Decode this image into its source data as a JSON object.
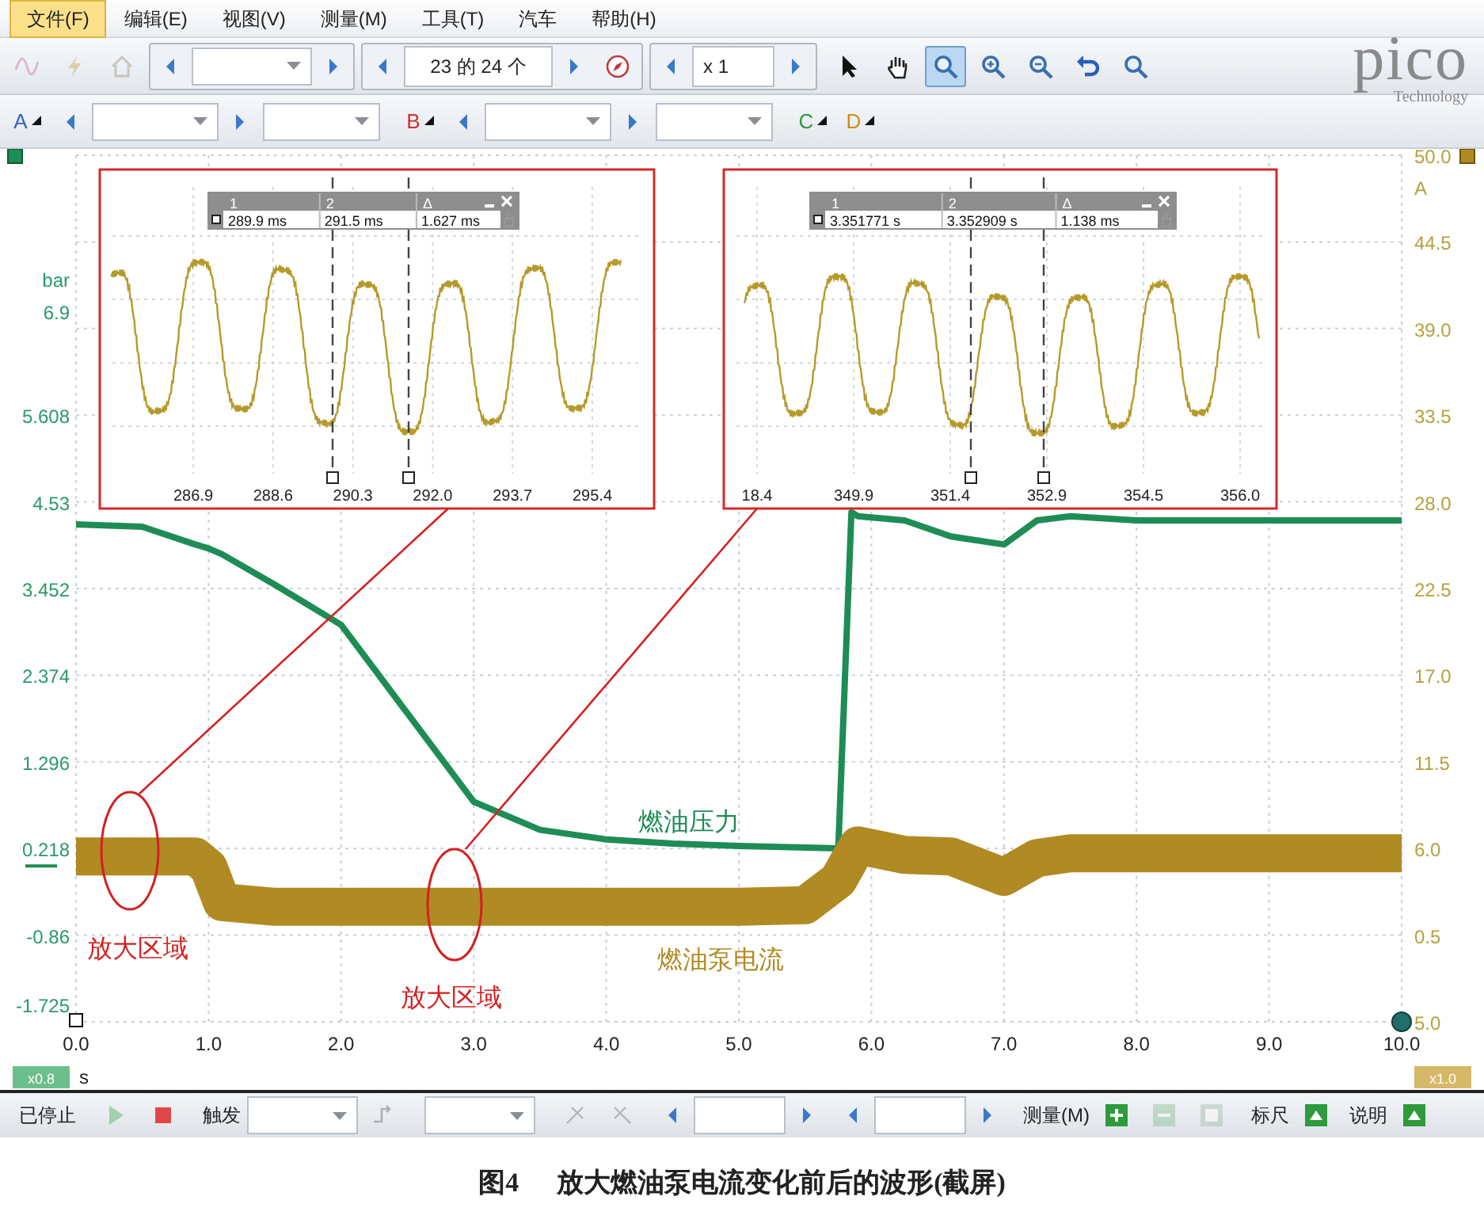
{
  "menu": {
    "items": [
      {
        "label": "文件(F)",
        "selected": true
      },
      {
        "label": "编辑(E)",
        "selected": false
      },
      {
        "label": "视图(V)",
        "selected": false
      },
      {
        "label": "测量(M)",
        "selected": false
      },
      {
        "label": "工具(T)",
        "selected": false
      },
      {
        "label": "汽车",
        "selected": false
      },
      {
        "label": "帮助(H)",
        "selected": false
      }
    ]
  },
  "toolbar_1": {
    "left_tools": [
      {
        "disabled": true
      },
      {
        "disabled": true
      },
      {
        "disabled": true
      }
    ],
    "buffer_counter": "23 的 24 个",
    "zoom_factor": "x 1",
    "view_tools": [
      {
        "selected": false
      },
      {
        "selected": false
      },
      {
        "selected": true
      },
      {
        "selected": false
      },
      {
        "selected": false
      },
      {
        "selected": false
      },
      {
        "selected": false
      }
    ],
    "logo": {
      "name": "pico",
      "tagline": "Technology"
    }
  },
  "toolbar_2": {
    "channels": [
      {
        "label": "A",
        "color": "#2f5fc4"
      },
      {
        "label": "B",
        "color": "#d03030"
      },
      {
        "label": "C",
        "color": "#2e9a3c"
      },
      {
        "label": "D",
        "color": "#d08a10"
      }
    ]
  },
  "scope": {
    "chart_data": {
      "type": "line",
      "xlabel": "s",
      "ylabel": "bar",
      "y2label": "A",
      "x": [
        0,
        0.5,
        0.9,
        1.0,
        1.1,
        1.5,
        2.0,
        2.5,
        3.0,
        3.5,
        4.0,
        4.5,
        5.0,
        5.5,
        5.75,
        5.85,
        5.9,
        6.25,
        6.6,
        7.0,
        7.25,
        7.5,
        8.0,
        9.0,
        10.0
      ],
      "series": [
        {
          "name": "燃油压力",
          "color": "#1e8c55",
          "values": [
            4.25,
            4.22,
            4.0,
            3.95,
            3.88,
            3.5,
            3.0,
            1.9,
            0.8,
            0.45,
            0.33,
            0.28,
            0.25,
            0.23,
            0.22,
            4.4,
            4.35,
            4.3,
            4.1,
            4.0,
            4.3,
            4.35,
            4.3,
            4.3,
            4.3
          ]
        },
        {
          "name": "燃油泵电流",
          "color": "#b08a22",
          "axis": "y2",
          "values": [
            5.5,
            5.5,
            5.5,
            4.8,
            2.6,
            2.3,
            2.3,
            2.3,
            2.3,
            2.3,
            2.3,
            2.3,
            2.3,
            2.4,
            4.0,
            5.5,
            6.2,
            5.6,
            5.5,
            4.2,
            5.4,
            5.7,
            5.7,
            5.7,
            5.7
          ]
        }
      ],
      "grid": true,
      "xlim": [
        0,
        10
      ],
      "ylim": [
        -1.938,
        8.842
      ],
      "y2lim": [
        -5,
        50
      ],
      "xticks": [
        {
          "value": 0,
          "label": "0.0"
        },
        {
          "value": 1,
          "label": "1.0"
        },
        {
          "value": 2,
          "label": "2.0"
        },
        {
          "value": 3,
          "label": "3.0"
        },
        {
          "value": 4,
          "label": "4.0"
        },
        {
          "value": 5,
          "label": "5.0"
        },
        {
          "value": 6,
          "label": "6.0"
        },
        {
          "value": 7,
          "label": "7.0"
        },
        {
          "value": 8,
          "label": "8.0"
        },
        {
          "value": 9,
          "label": "9.0"
        },
        {
          "value": 10,
          "label": "10.0"
        }
      ],
      "yticks": [
        {
          "value": 6.9,
          "label": "6.9"
        },
        {
          "value": 5.608,
          "label": "5.608"
        },
        {
          "value": 4.53,
          "label": "4.53"
        },
        {
          "value": 3.452,
          "label": "3.452"
        },
        {
          "value": 2.374,
          "label": "2.374"
        },
        {
          "value": 1.296,
          "label": "1.296"
        },
        {
          "value": 0.218,
          "label": "0.218"
        },
        {
          "value": -0.86,
          "label": "-0.86"
        },
        {
          "value": -1.725,
          "label": "-1.725"
        }
      ],
      "y2ticks": [
        {
          "value": 50,
          "label": "50.0"
        },
        {
          "value": 44.5,
          "label": "44.5"
        },
        {
          "value": 39,
          "label": "39.0"
        },
        {
          "value": 33.5,
          "label": "33.5"
        },
        {
          "value": 28,
          "label": "28.0"
        },
        {
          "value": 22.5,
          "label": "22.5"
        },
        {
          "value": 17,
          "label": "17.0"
        },
        {
          "value": 11.5,
          "label": "11.5"
        },
        {
          "value": 6,
          "label": "6.0"
        },
        {
          "value": 0.5,
          "label": "0.5"
        },
        {
          "value": -5,
          "label": "5.0"
        }
      ],
      "annotations": [
        {
          "text": "放大区域"
        },
        {
          "text": "放大区域"
        }
      ]
    },
    "axis_scale": {
      "left": "x0.8",
      "right": "x1.0"
    },
    "insets": [
      {
        "cursor_table": {
          "columns": [
            "1",
            "2",
            "Δ"
          ],
          "values": [
            "289.9 ms",
            "291.5 ms",
            "1.627 ms"
          ]
        },
        "xticks": [
          "286.9",
          "288.6",
          "290.3",
          "292.0",
          "293.7",
          "295.4"
        ]
      },
      {
        "cursor_table": {
          "columns": [
            "1",
            "2",
            "Δ"
          ],
          "values": [
            "3.351771 s",
            "3.352909 s",
            "1.138 ms"
          ]
        },
        "xticks": [
          "18.4",
          "349.9",
          "351.4",
          "352.9",
          "354.5",
          "356.0"
        ]
      }
    ]
  },
  "bottom_toolbar": {
    "status": "已停止",
    "run_controls": [
      {
        "disabled": true
      },
      {
        "disabled": false
      }
    ],
    "trigger_label": "触发",
    "measure_label": "测量(M)",
    "measure_buttons": [
      {
        "disabled": false
      },
      {
        "disabled": true
      },
      {
        "disabled": true
      }
    ],
    "ruler_label": "标尺",
    "notes_label": "说明"
  },
  "caption": {
    "label": "图4",
    "text": "放大燃油泵电流变化前后的波形(截屏)"
  }
}
